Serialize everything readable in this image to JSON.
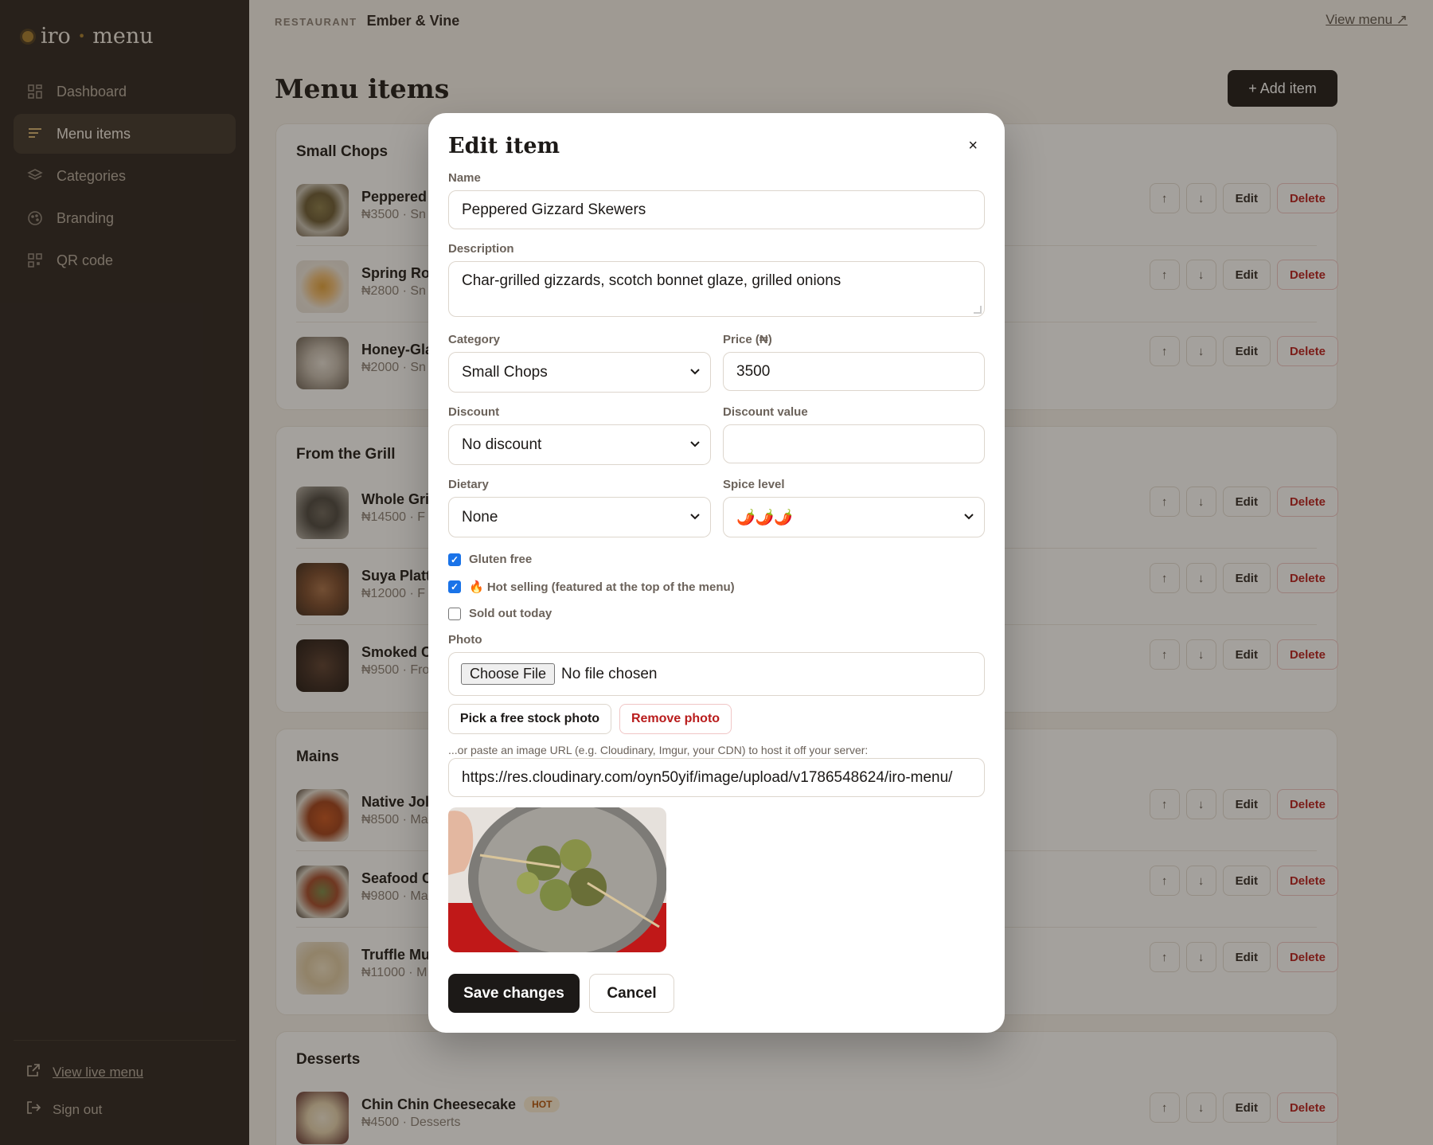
{
  "sidebar": {
    "logo": {
      "left": "iro",
      "sep": "•",
      "right": "menu"
    },
    "nav": [
      {
        "label": "Dashboard",
        "icon": "grid-icon"
      },
      {
        "label": "Menu items",
        "icon": "list-icon"
      },
      {
        "label": "Categories",
        "icon": "layers-icon"
      },
      {
        "label": "Branding",
        "icon": "palette-icon"
      },
      {
        "label": "QR code",
        "icon": "qr-icon"
      }
    ],
    "view_live": "View live menu",
    "sign_out": "Sign out"
  },
  "topbar": {
    "label": "RESTAURANT",
    "name": "Ember & Vine",
    "view_menu": "View menu ↗"
  },
  "page": {
    "title": "Menu items",
    "add_button": "+ Add item"
  },
  "sections": [
    {
      "title": "Small Chops",
      "items": [
        {
          "name": "Peppered",
          "meta": "₦3500 · Sn"
        },
        {
          "name": "Spring Ro",
          "meta": "₦2800 · Sn"
        },
        {
          "name": "Honey-Gla",
          "meta": "₦2000 · Sn"
        }
      ]
    },
    {
      "title": "From the Grill",
      "items": [
        {
          "name": "Whole Gri",
          "meta": "₦14500 · F"
        },
        {
          "name": "Suya Platt",
          "meta": "₦12000 · F"
        },
        {
          "name": "Smoked C",
          "meta": "₦9500 · Fro"
        }
      ]
    },
    {
      "title": "Mains",
      "items": [
        {
          "name": "Native Jol",
          "meta": "₦8500 · Ma"
        },
        {
          "name": "Seafood C",
          "meta": "₦9800 · Ma"
        },
        {
          "name": "Truffle Mu",
          "meta": "₦11000 · M"
        }
      ]
    },
    {
      "title": "Desserts",
      "items": [
        {
          "name": "Chin Chin Cheesecake",
          "meta": "₦4500 · Desserts",
          "badge": "HOT"
        }
      ]
    }
  ],
  "row_actions": {
    "up": "↑",
    "down": "↓",
    "edit": "Edit",
    "delete": "Delete"
  },
  "modal": {
    "title": "Edit item",
    "close": "×",
    "name_label": "Name",
    "name_value": "Peppered Gizzard Skewers",
    "description_label": "Description",
    "description_value": "Char-grilled gizzards, scotch bonnet glaze, grilled onions",
    "category_label": "Category",
    "category_value": "Small Chops",
    "price_label": "Price (₦)",
    "price_value": "3500",
    "discount_label": "Discount",
    "discount_value": "No discount",
    "discount_value_label": "Discount value",
    "discount_value_value": "",
    "dietary_label": "Dietary",
    "dietary_value": "None",
    "spice_label": "Spice level",
    "spice_value": "🌶️🌶️🌶️",
    "checks": [
      {
        "label": "Gluten free",
        "checked": true
      },
      {
        "label": "🔥 Hot selling (featured at the top of the menu)",
        "checked": true
      },
      {
        "label": "Sold out today",
        "checked": false
      }
    ],
    "photo_label": "Photo",
    "file_button": "Choose File",
    "file_status": "No file chosen",
    "stock_button": "Pick a free stock photo",
    "remove_button": "Remove photo",
    "url_hint": "...or paste an image URL (e.g. Cloudinary, Imgur, your CDN) to host it off your server:",
    "url_value": "https://res.cloudinary.com/oyn50yif/image/upload/v1786548624/iro-menu/",
    "save_button": "Save changes",
    "cancel_button": "Cancel"
  },
  "colors": {
    "sidebar_bg": "#2a2420",
    "accent": "#a67c2e",
    "primary_btn": "#1c1917",
    "danger": "#b91c1c",
    "overlay": "rgba(38,30,22,0.42)"
  }
}
